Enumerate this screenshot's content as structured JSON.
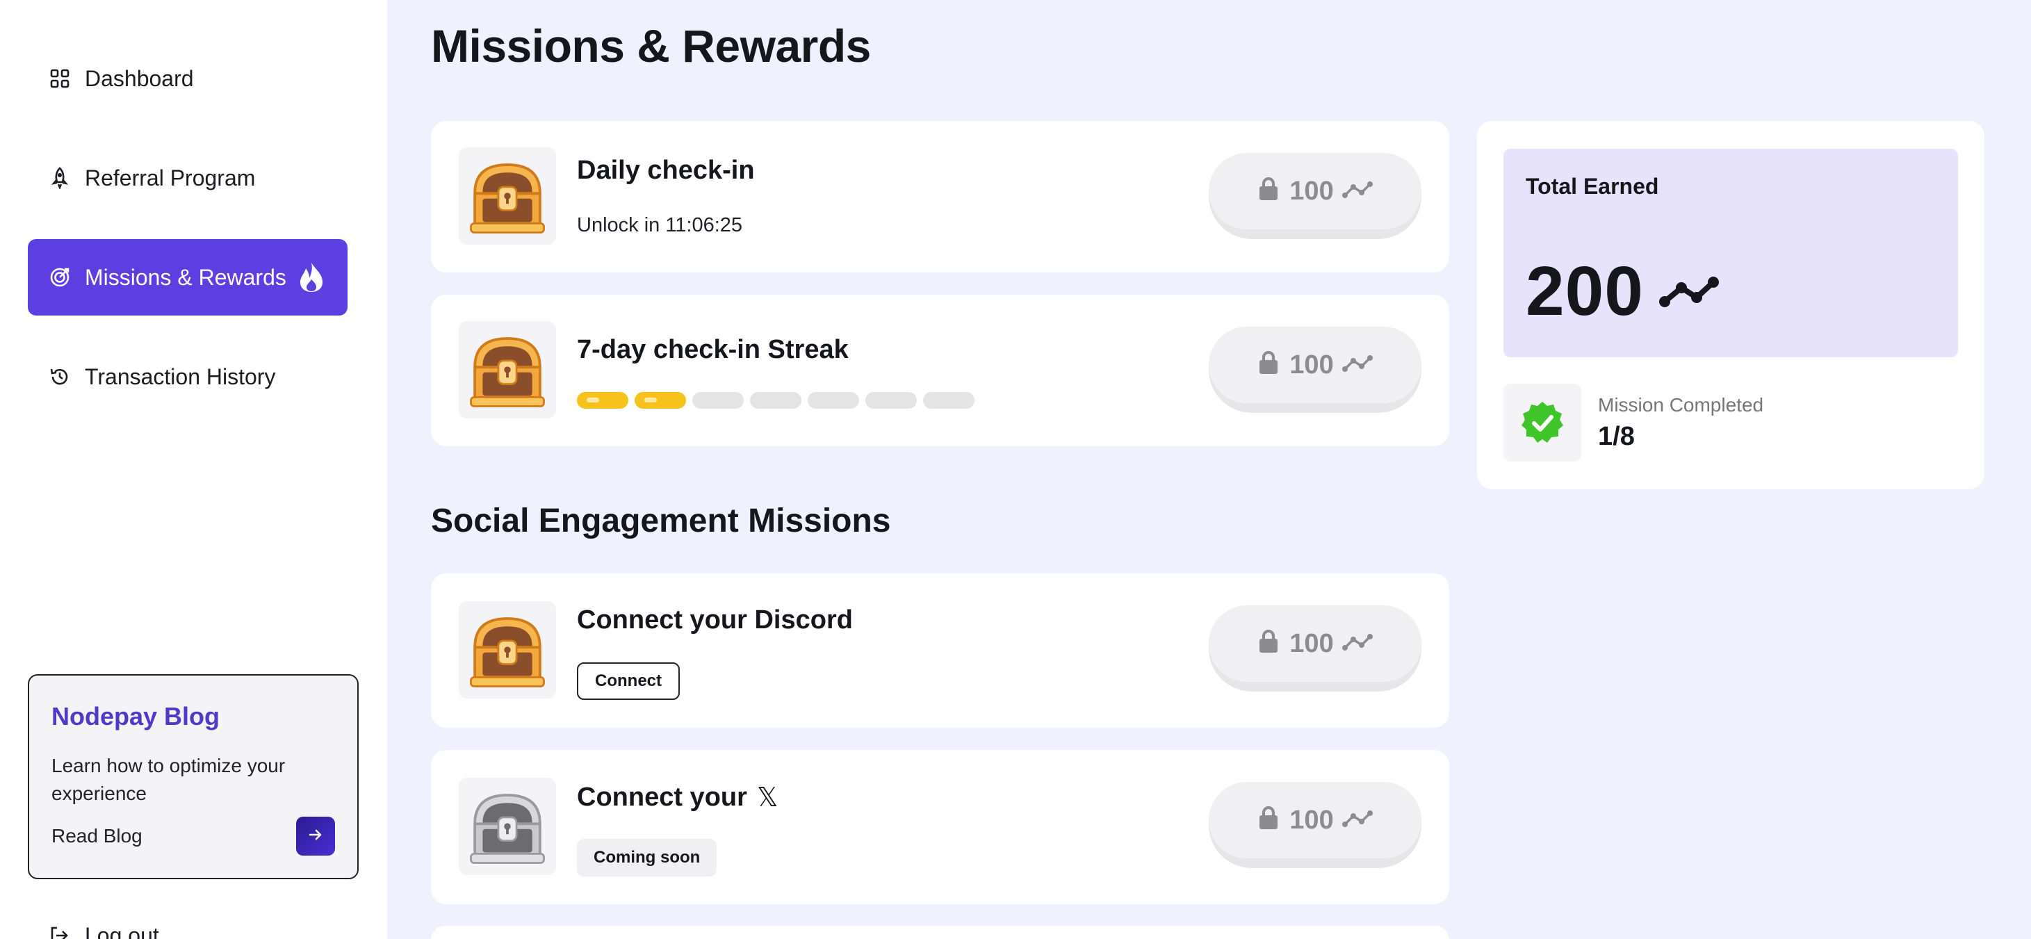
{
  "sidebar": {
    "nav": [
      {
        "label": "Dashboard",
        "icon": "grid-icon"
      },
      {
        "label": "Referral Program",
        "icon": "rocket-icon"
      },
      {
        "label": "Missions & Rewards",
        "icon": "target-icon",
        "active": true
      },
      {
        "label": "Transaction History",
        "icon": "history-icon"
      }
    ],
    "blog": {
      "title": "Nodepay Blog",
      "description": "Learn how to optimize your experience",
      "link_label": "Read Blog"
    },
    "logout_label": "Log out"
  },
  "main": {
    "title": "Missions & Rewards",
    "daily_missions": [
      {
        "name": "Daily check-in",
        "subtitle": "Unlock in 11:06:25",
        "reward": "100",
        "chest": "gold"
      },
      {
        "name": "7-day check-in Streak",
        "reward": "100",
        "chest": "gold",
        "streak": {
          "completed": 2,
          "total": 7
        }
      }
    ],
    "social_section_title": "Social Engagement Missions",
    "social_missions": [
      {
        "name": "Connect your Discord",
        "action_label": "Connect",
        "reward": "100",
        "chest": "gold"
      },
      {
        "name": "Connect your",
        "platform_glyph": "𝕏",
        "status_label": "Coming soon",
        "reward": "100",
        "chest": "silver"
      }
    ]
  },
  "stats": {
    "total_earned_label": "Total Earned",
    "total_earned_value": "200",
    "mission_completed_label": "Mission Completed",
    "mission_completed_value": "1/8"
  },
  "colors": {
    "accent": "#5b3fe0",
    "background": "#eff1fe",
    "earned_panel": "#e8e3fd",
    "streak_fill": "#f8c21c",
    "check_green": "#3fc52a"
  }
}
